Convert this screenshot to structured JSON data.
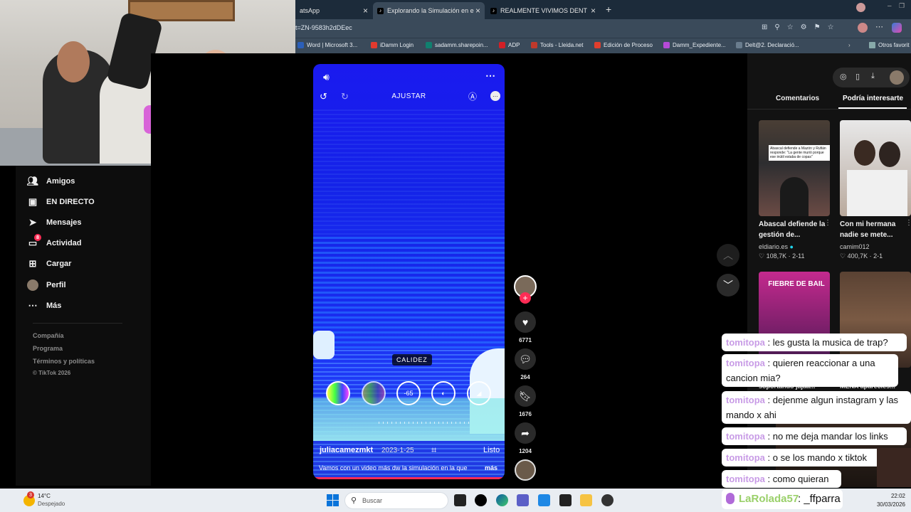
{
  "browser": {
    "tabs": [
      {
        "label": "atsApp"
      },
      {
        "label": "Explorando la Simulación en el Cie"
      },
      {
        "label": "REALMENTE VIVIMOS DENTRO DE"
      }
    ],
    "url": "t=ZN-9583h2dDEec",
    "bookmarks": [
      "Word | Microsoft 3...",
      "iDamm Login",
      "sadamm.sharepoin...",
      "ADP",
      "Tools - Lleida.net",
      "Edición de Proceso",
      "Damm_Expediente...",
      "Delt@2. Declaració...",
      "Otros favorit"
    ]
  },
  "nav": {
    "items": [
      "Amigos",
      "EN DIRECTO",
      "Mensajes",
      "Actividad",
      "Cargar",
      "Perfil",
      "Más"
    ],
    "activity_badge": "8",
    "footer": [
      "Compañía",
      "Programa",
      "Términos y políticas",
      "© TikTok 2026"
    ]
  },
  "video": {
    "top_label": "AJUSTAR",
    "center_label": "CALIDEZ",
    "dial_value": "-65",
    "done_label": "Listo",
    "author": "juliacamezmkt",
    "date": "2023-1-25",
    "caption": "Vamos con un video más dw la simulación en la que",
    "more": "más"
  },
  "actions": {
    "likes": "6771",
    "comments": "264",
    "saves": "1676",
    "shares": "1204"
  },
  "panel": {
    "tabs": [
      "Comentarios",
      "Podría interesarte"
    ],
    "cards": [
      {
        "title": "Abascal defiende la gestión de...",
        "author": "eldiario.es",
        "likes": "108,7K",
        "date": "2-11",
        "overlay": "Abascal defiende a Mazón y Rufián responde: \"La gente murió porque ese inútil estaba de copas\""
      },
      {
        "title": "Con mi hermana nadie se mete...",
        "author": "camim012",
        "likes": "400,7K",
        "date": "2-1",
        "overlay": ""
      },
      {
        "title": "soportando jajaa...",
        "overlay": "FIEBRE DE BAIL"
      },
      {
        "title": "MENA aparecies...",
        "overlay": ""
      }
    ]
  },
  "chat": [
    {
      "user": "tomitopa",
      "text": "les gusta la musica de trap?"
    },
    {
      "user": "tomitopa",
      "text": "quieren reaccionar a una cancion mia?"
    },
    {
      "user": "tomitopa",
      "text": "dejenme algun instagram y las mando x ahi"
    },
    {
      "user": "tomitopa",
      "text": "no me deja mandar los links"
    },
    {
      "user": "tomitopa",
      "text": "o se los mando x tiktok"
    },
    {
      "user": "tomitopa",
      "text": "como quieran"
    },
    {
      "user": "LaRolada57",
      "text": "_ffparra"
    }
  ],
  "taskbar": {
    "weather_temp": "14°C",
    "weather_desc": "Despejado",
    "weather_badge": "3",
    "search_placeholder": "Buscar",
    "time": "22:02",
    "date": "30/03/2026"
  }
}
